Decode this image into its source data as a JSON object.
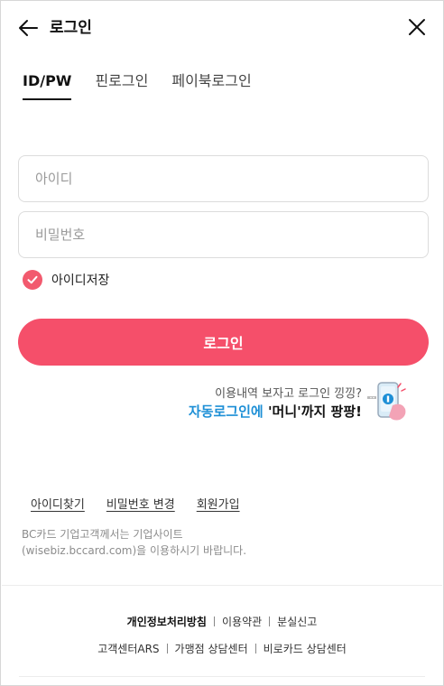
{
  "header": {
    "title": "로그인",
    "back_icon": "arrow-left-icon",
    "close_icon": "close-icon"
  },
  "tabs": [
    {
      "label": "ID/PW",
      "active": true
    },
    {
      "label": "핀로그인",
      "active": false
    },
    {
      "label": "페이북로그인",
      "active": false
    }
  ],
  "form": {
    "id_placeholder": "아이디",
    "pw_placeholder": "비밀번호",
    "save_id_label": "아이디저장",
    "save_id_checked": true,
    "login_label": "로그인"
  },
  "promo": {
    "line1": "이용내역 보자고 로그인 낑낑?",
    "line2_blue": "자동로그인에",
    "line2_dark": "'머니'까지 팡팡!"
  },
  "links": {
    "find_id": "아이디찾기",
    "change_pw": "비밀번호 변경",
    "signup": "회원가입"
  },
  "notice": {
    "line1": "BC카드 기업고객께서는 기업사이트",
    "line2": "(wisebiz.bccard.com)을 이용하시기 바랍니다."
  },
  "footer": {
    "privacy": "개인정보처리방침",
    "terms": "이용약관",
    "lost": "분실신고",
    "ars": "고객센터ARS",
    "merchant": "가맹점 상담센터",
    "noncard": "비로카드 상담센터"
  },
  "colors": {
    "accent": "#f54f6a",
    "blue": "#1d8fd6"
  }
}
